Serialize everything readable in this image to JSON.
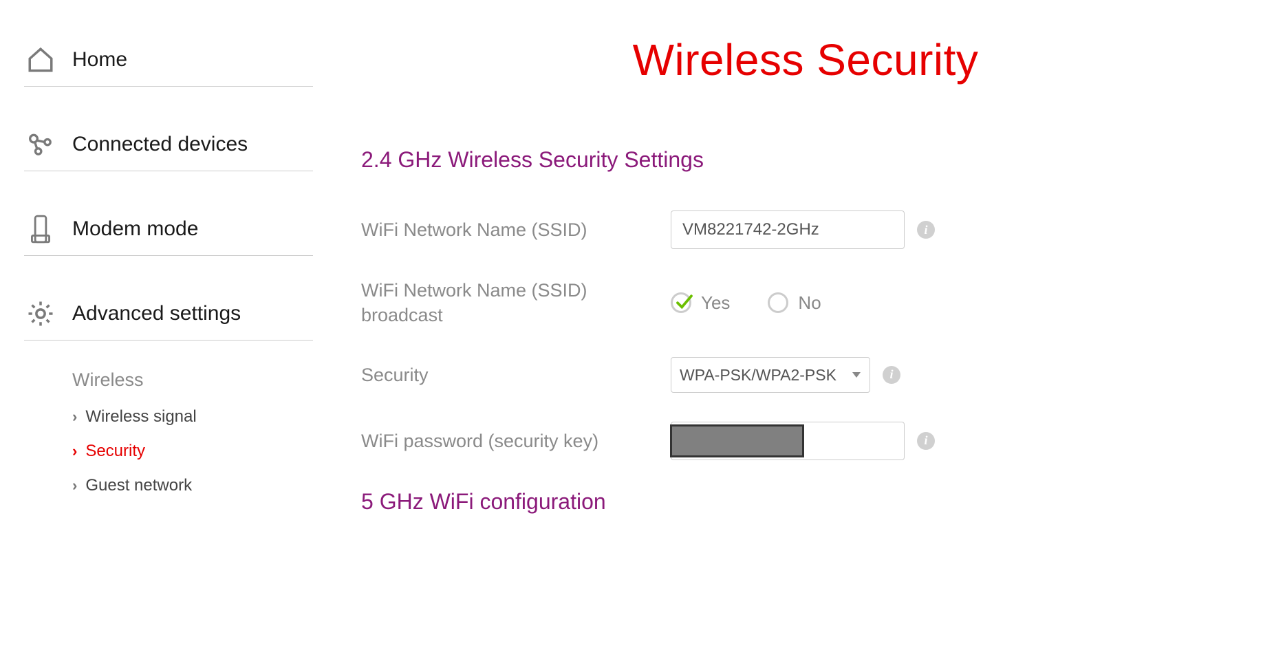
{
  "sidebar": {
    "nav": [
      {
        "label": "Home"
      },
      {
        "label": "Connected devices"
      },
      {
        "label": "Modem mode"
      },
      {
        "label": "Advanced settings"
      }
    ],
    "subheading": "Wireless",
    "subitems": [
      {
        "label": "Wireless signal",
        "active": false
      },
      {
        "label": "Security",
        "active": true
      },
      {
        "label": "Guest network",
        "active": false
      }
    ]
  },
  "main": {
    "title": "Wireless Security",
    "section24": {
      "heading": "2.4 GHz Wireless Security Settings",
      "ssid_label": "WiFi Network Name (SSID)",
      "ssid_value": "VM8221742-2GHz",
      "broadcast_label": "WiFi Network Name (SSID) broadcast",
      "broadcast_yes": "Yes",
      "broadcast_no": "No",
      "broadcast_selected": "yes",
      "security_label": "Security",
      "security_value": "WPA-PSK/WPA2-PSK",
      "password_label": "WiFi password (security key)"
    },
    "section5": {
      "heading": "5 GHz WiFi configuration"
    }
  }
}
